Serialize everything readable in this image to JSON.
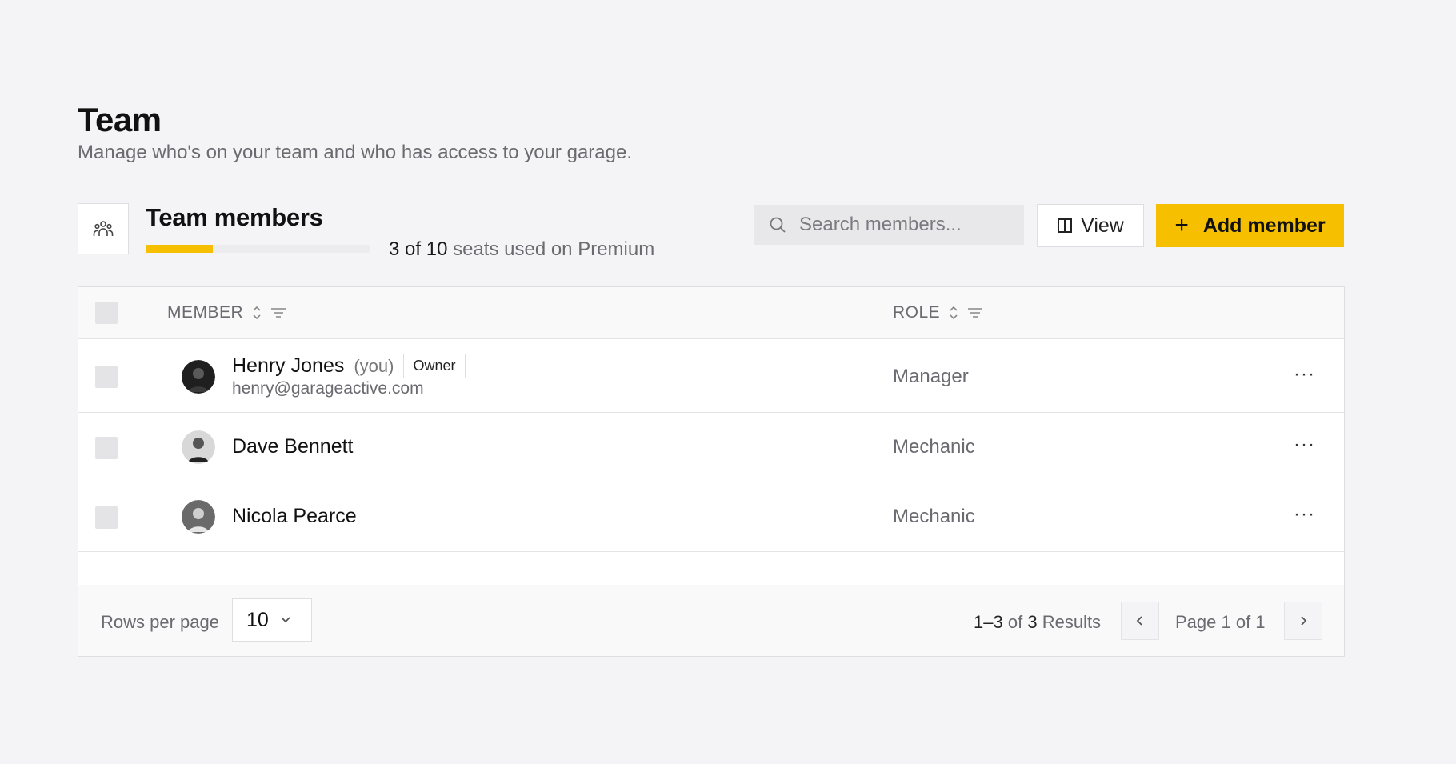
{
  "page": {
    "title": "Team",
    "subtitle": "Manage who's on your team and who has access to your garage."
  },
  "members_section": {
    "title": "Team members",
    "icon": "team-icon",
    "seats_used": "3",
    "seats_total": "10",
    "seats_suffix": "seats used on Premium",
    "seats_fraction": 0.3,
    "search_placeholder": "Search members...",
    "view_label": "View",
    "add_label": "Add member",
    "accent_color": "#f6c000"
  },
  "table": {
    "col_member": "MEMBER",
    "col_role": "ROLE",
    "rows": [
      {
        "name": "Henry Jones",
        "you": "(you)",
        "badge": "Owner",
        "email": "henry@garageactive.com",
        "role": "Manager",
        "actions": "···"
      },
      {
        "name": "Dave Bennett",
        "role": "Mechanic",
        "actions": "···"
      },
      {
        "name": "Nicola Pearce",
        "role": "Mechanic",
        "actions": "···"
      }
    ]
  },
  "footer": {
    "rows_per_page_label": "Rows per page",
    "rows_per_page_value": "10",
    "range": "1–3",
    "of_word": "of",
    "total": "3",
    "results_word": "Results",
    "page_text": "Page 1 of 1"
  }
}
